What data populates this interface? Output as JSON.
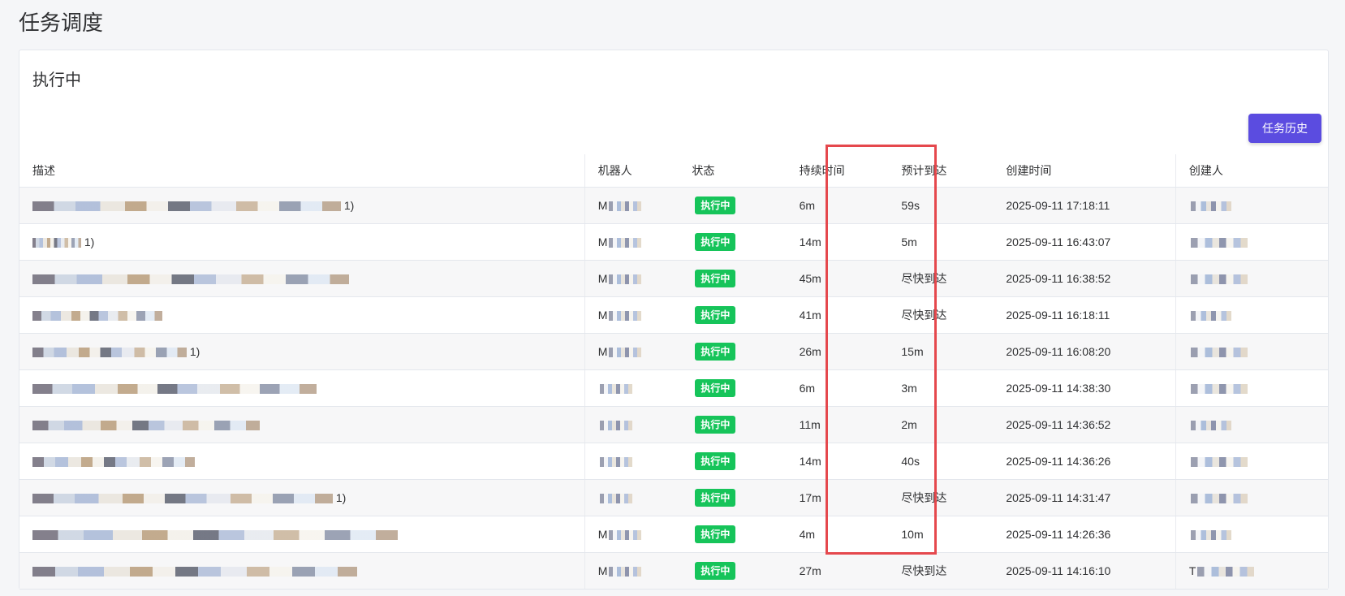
{
  "page": {
    "title": "任务调度"
  },
  "card": {
    "title": "执行中",
    "history_button": "任务历史"
  },
  "table": {
    "columns": [
      "描述",
      "机器人",
      "状态",
      "持续时间",
      "预计到达",
      "创建时间",
      "创建人"
    ],
    "rows": [
      {
        "desc_tail": "1)",
        "robot": "M",
        "status": "执行中",
        "duration": "6m",
        "eta": "59s",
        "created": "2025-09-11 17:18:11",
        "creator": ""
      },
      {
        "desc_tail": "1)",
        "robot": "M",
        "status": "执行中",
        "duration": "14m",
        "eta": "5m",
        "created": "2025-09-11 16:43:07",
        "creator": ""
      },
      {
        "desc_tail": "",
        "robot": "M",
        "status": "执行中",
        "duration": "45m",
        "eta": "尽快到达",
        "created": "2025-09-11 16:38:52",
        "creator": ""
      },
      {
        "desc_tail": "",
        "robot": "M",
        "status": "执行中",
        "duration": "41m",
        "eta": "尽快到达",
        "created": "2025-09-11 16:18:11",
        "creator": ""
      },
      {
        "desc_tail": "1)",
        "robot": "M",
        "status": "执行中",
        "duration": "26m",
        "eta": "15m",
        "created": "2025-09-11 16:08:20",
        "creator": ""
      },
      {
        "desc_tail": "",
        "robot": "",
        "status": "执行中",
        "duration": "6m",
        "eta": "3m",
        "created": "2025-09-11 14:38:30",
        "creator": ""
      },
      {
        "desc_tail": "",
        "robot": "",
        "status": "执行中",
        "duration": "11m",
        "eta": "2m",
        "created": "2025-09-11 14:36:52",
        "creator": ""
      },
      {
        "desc_tail": "",
        "robot": "",
        "status": "执行中",
        "duration": "14m",
        "eta": "40s",
        "created": "2025-09-11 14:36:26",
        "creator": ""
      },
      {
        "desc_tail": "1)",
        "robot": "",
        "status": "执行中",
        "duration": "17m",
        "eta": "尽快到达",
        "created": "2025-09-11 14:31:47",
        "creator": ""
      },
      {
        "desc_tail": "",
        "robot": "M",
        "status": "执行中",
        "duration": "4m",
        "eta": "10m",
        "created": "2025-09-11 14:26:36",
        "creator": ""
      },
      {
        "desc_tail": "",
        "robot": "M",
        "status": "执行中",
        "duration": "27m",
        "eta": "尽快到达",
        "created": "2025-09-11 14:16:10",
        "creator": "T"
      }
    ]
  },
  "colors": {
    "accent": "#5b4ce0",
    "status_running": "#16c45a",
    "highlight_box": "#e5484d"
  }
}
